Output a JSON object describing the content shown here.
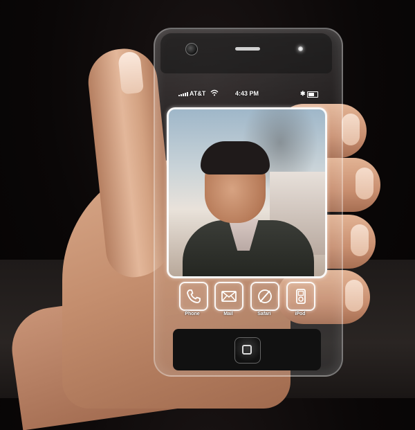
{
  "status_bar": {
    "carrier": "AT&T",
    "wifi_icon": "wifi-icon",
    "time": "4:43 PM",
    "bluetooth_glyph": "✱",
    "battery_icon": "battery-icon"
  },
  "wallpaper": {
    "description_icon": "photo"
  },
  "dock": {
    "items": [
      {
        "label": "Phone",
        "icon": "phone-icon"
      },
      {
        "label": "Mail",
        "icon": "mail-icon"
      },
      {
        "label": "Safari",
        "icon": "compass-icon"
      },
      {
        "label": "iPod",
        "icon": "ipod-icon"
      }
    ]
  },
  "colors": {
    "background": "#0a0707",
    "glass_border": "#ffffff",
    "status_text": "#ffffff"
  }
}
